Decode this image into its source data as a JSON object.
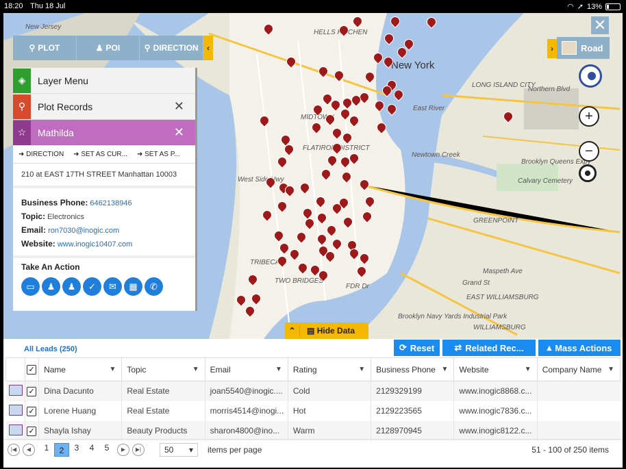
{
  "status": {
    "time": "18:20",
    "date": "Thu 18 Jul",
    "battery": "13%"
  },
  "map": {
    "labels": [
      "HELLS KITCHEN",
      "New York",
      "MIDTOWN",
      "LONG ISLAND CITY",
      "Northern Blvd",
      "East River",
      "FLATIRON DISTRICT",
      "Newtown Creek",
      "Calvary Cemetery",
      "GREENPOINT",
      "TRIBECA",
      "TWO BRIDGES",
      "EAST WILLIAMSBURG",
      "WILLIAMSBURG",
      "Brooklyn Navy Yards Industrial Park",
      "New Jersey",
      "West Side Hwy",
      "FDR Dr",
      "Grand St",
      "Maspeth Ave",
      "Brooklyn Queens Expy"
    ],
    "toolbar": {
      "plot": "PLOT",
      "poi": "POI",
      "direction": "DIRECTION"
    },
    "road_label": "Road",
    "close_label": "✕"
  },
  "panel": {
    "layer_menu": "Layer Menu",
    "plot_records": "Plot Records",
    "record_name": "Mathilda",
    "actions": [
      "DIRECTION",
      "SET AS CUR...",
      "SET AS P..."
    ],
    "address": "210 at EAST 17TH STREET Manhattan 10003",
    "fields": [
      {
        "label": "Business Phone:",
        "value": "6462138946"
      },
      {
        "label": "Topic:",
        "value": "Electronics"
      },
      {
        "label": "Email:",
        "value": "ron7030@inogic.com"
      },
      {
        "label": "Website:",
        "value": "www.inogic10407.com"
      }
    ],
    "take_action": "Take An Action",
    "action_icons": [
      "folder-icon",
      "user-icon",
      "users-icon",
      "assign-icon",
      "email-icon",
      "calendar-icon",
      "phone-icon"
    ]
  },
  "hide_data": "Hide Data",
  "grid": {
    "title": "All Leads (250)",
    "buttons": {
      "reset": "Reset",
      "related": "Related Rec...",
      "mass": "Mass Actions"
    },
    "columns": [
      "Name",
      "Topic",
      "Email",
      "Rating",
      "Business Phone",
      "Website",
      "Company Name"
    ],
    "rows": [
      {
        "name": "Dina Dacunto",
        "topic": "Real Estate",
        "email": "joan5540@inogic....",
        "rating": "Cold",
        "phone": "2129329199",
        "website": "www.inogic8868.c...",
        "company": ""
      },
      {
        "name": "Lorene Huang",
        "topic": "Real Estate",
        "email": "morris4514@inogi...",
        "rating": "Hot",
        "phone": "2129223565",
        "website": "www.inogic7836.c...",
        "company": ""
      },
      {
        "name": "Shayla Ishay",
        "topic": "Beauty Products",
        "email": "sharon4800@ino...",
        "rating": "Warm",
        "phone": "2128970945",
        "website": "www.inogic8122.c...",
        "company": ""
      }
    ]
  },
  "pager": {
    "pages": [
      "1",
      "2",
      "3",
      "4",
      "5"
    ],
    "current": "2",
    "page_size": "50",
    "items_label": "items per page",
    "summary": "51 - 100 of 250 items"
  },
  "colors": {
    "accent_blue": "#1a8cf0",
    "toolbar": "#8fb0c9",
    "collapse": "#f5b800",
    "pin": "#9e1a1a",
    "layer_green": "#2e9e2e",
    "plot_red": "#d84a2e",
    "record_pink": "#c06cc0"
  }
}
